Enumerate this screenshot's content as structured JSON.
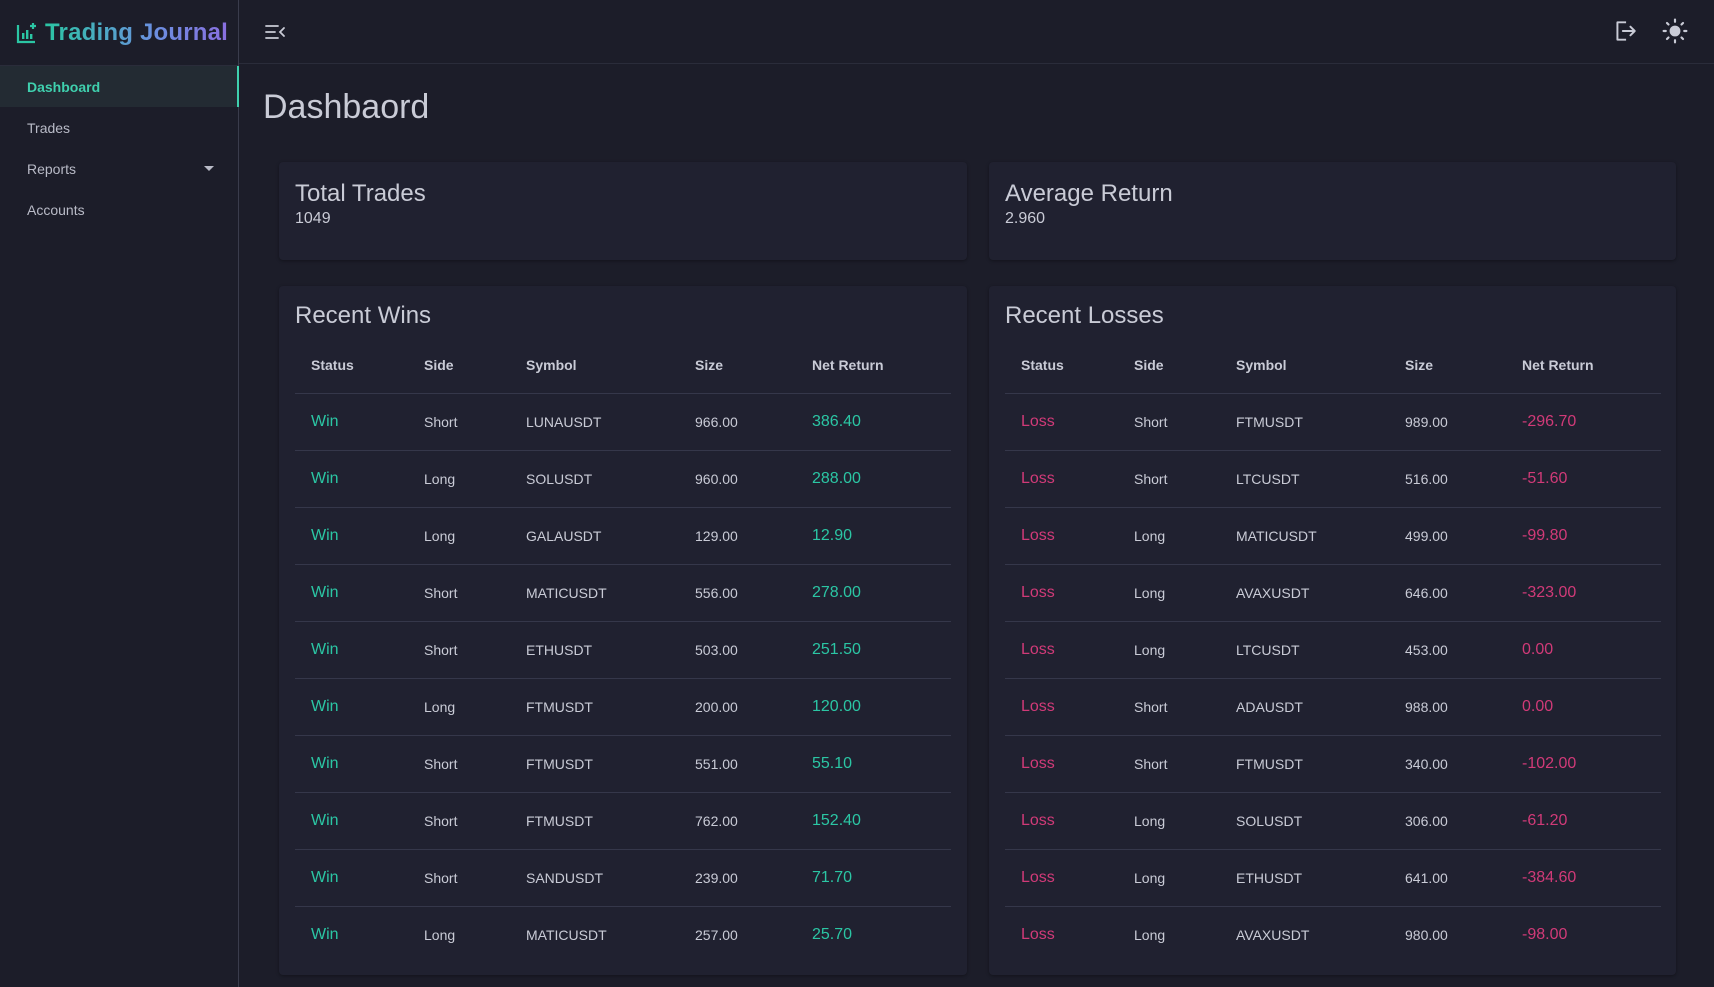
{
  "app": {
    "title": "Trading Journal",
    "accent": "#3fd0ae",
    "win_color": "#2bc6a4",
    "loss_color": "#d13a78"
  },
  "sidebar": {
    "items": [
      {
        "label": "Dashboard",
        "active": true
      },
      {
        "label": "Trades"
      },
      {
        "label": "Reports",
        "has_dropdown": true
      },
      {
        "label": "Accounts"
      }
    ]
  },
  "topbar": {
    "icons": [
      "menu-collapse-icon",
      "logout-icon",
      "sun-icon"
    ]
  },
  "page": {
    "title": "Dashbaord"
  },
  "stats": {
    "total_trades": {
      "label": "Total Trades",
      "value": "1049"
    },
    "average_return": {
      "label": "Average Return",
      "value": "2.960"
    }
  },
  "recent_wins": {
    "title": "Recent Wins",
    "columns": [
      "Status",
      "Side",
      "Symbol",
      "Size",
      "Net Return"
    ],
    "rows": [
      [
        "Win",
        "Short",
        "LUNAUSDT",
        "966.00",
        "386.40"
      ],
      [
        "Win",
        "Long",
        "SOLUSDT",
        "960.00",
        "288.00"
      ],
      [
        "Win",
        "Long",
        "GALAUSDT",
        "129.00",
        "12.90"
      ],
      [
        "Win",
        "Short",
        "MATICUSDT",
        "556.00",
        "278.00"
      ],
      [
        "Win",
        "Short",
        "ETHUSDT",
        "503.00",
        "251.50"
      ],
      [
        "Win",
        "Long",
        "FTMUSDT",
        "200.00",
        "120.00"
      ],
      [
        "Win",
        "Short",
        "FTMUSDT",
        "551.00",
        "55.10"
      ],
      [
        "Win",
        "Short",
        "FTMUSDT",
        "762.00",
        "152.40"
      ],
      [
        "Win",
        "Short",
        "SANDUSDT",
        "239.00",
        "71.70"
      ],
      [
        "Win",
        "Long",
        "MATICUSDT",
        "257.00",
        "25.70"
      ]
    ]
  },
  "recent_losses": {
    "title": "Recent Losses",
    "columns": [
      "Status",
      "Side",
      "Symbol",
      "Size",
      "Net Return"
    ],
    "rows": [
      [
        "Loss",
        "Short",
        "FTMUSDT",
        "989.00",
        "-296.70"
      ],
      [
        "Loss",
        "Short",
        "LTCUSDT",
        "516.00",
        "-51.60"
      ],
      [
        "Loss",
        "Long",
        "MATICUSDT",
        "499.00",
        "-99.80"
      ],
      [
        "Loss",
        "Long",
        "AVAXUSDT",
        "646.00",
        "-323.00"
      ],
      [
        "Loss",
        "Long",
        "LTCUSDT",
        "453.00",
        "0.00"
      ],
      [
        "Loss",
        "Short",
        "ADAUSDT",
        "988.00",
        "0.00"
      ],
      [
        "Loss",
        "Short",
        "FTMUSDT",
        "340.00",
        "-102.00"
      ],
      [
        "Loss",
        "Long",
        "SOLUSDT",
        "306.00",
        "-61.20"
      ],
      [
        "Loss",
        "Long",
        "ETHUSDT",
        "641.00",
        "-384.60"
      ],
      [
        "Loss",
        "Long",
        "AVAXUSDT",
        "980.00",
        "-98.00"
      ]
    ]
  }
}
